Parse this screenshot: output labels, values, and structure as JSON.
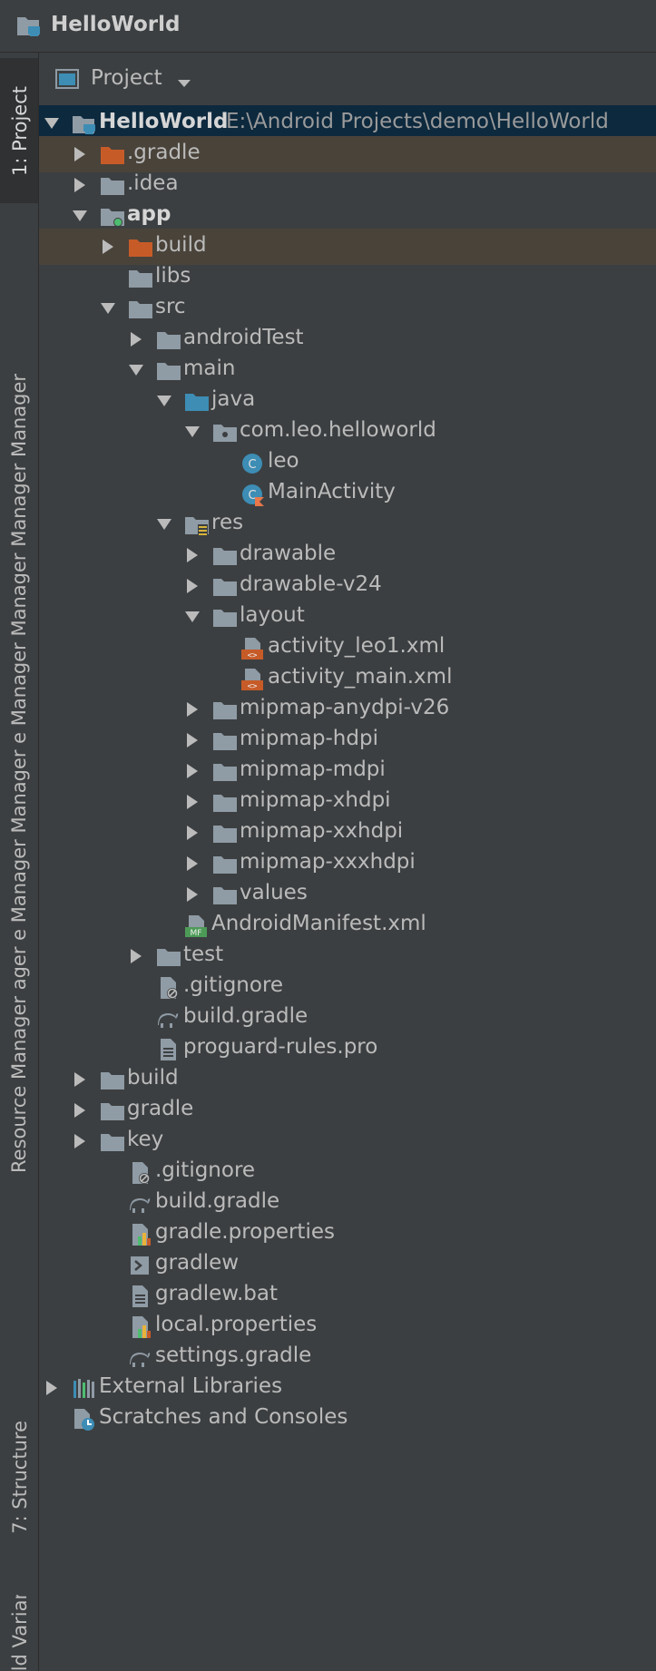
{
  "window": {
    "title": "HelloWorld"
  },
  "toolwindow_stripe": {
    "project_tab": "1: Project",
    "resource_tab": "Resource Manager  ager  e Manager  Manager  e Manager  Manager  Manager  Manager",
    "structure_tab": "7: Structure",
    "build_variants_tab": "Build Variants"
  },
  "panel": {
    "view_label": "Project"
  },
  "tree": [
    {
      "label": "HelloWorld",
      "level": 0,
      "arrow": "down",
      "icon": "project",
      "bold": true,
      "path": "E:\\Android Projects\\demo\\HelloWorld",
      "state": "selected"
    },
    {
      "label": ".gradle",
      "level": 1,
      "arrow": "right",
      "icon": "folder-excluded",
      "state": "excluded"
    },
    {
      "label": ".idea",
      "level": 1,
      "arrow": "right",
      "icon": "folder"
    },
    {
      "label": "app",
      "level": 1,
      "arrow": "down",
      "icon": "module",
      "bold": true
    },
    {
      "label": "build",
      "level": 2,
      "arrow": "right",
      "icon": "folder-excluded",
      "state": "excluded"
    },
    {
      "label": "libs",
      "level": 2,
      "icon": "folder"
    },
    {
      "label": "src",
      "level": 2,
      "arrow": "down",
      "icon": "folder"
    },
    {
      "label": "androidTest",
      "level": 3,
      "arrow": "right",
      "icon": "folder"
    },
    {
      "label": "main",
      "level": 3,
      "arrow": "down",
      "icon": "folder"
    },
    {
      "label": "java",
      "level": 4,
      "arrow": "down",
      "icon": "folder-source"
    },
    {
      "label": "com.leo.helloworld",
      "level": 5,
      "arrow": "down",
      "icon": "package"
    },
    {
      "label": "leo",
      "level": 6,
      "icon": "class"
    },
    {
      "label": "MainActivity",
      "level": 6,
      "icon": "kotlin-class"
    },
    {
      "label": "res",
      "level": 4,
      "arrow": "down",
      "icon": "folder-res"
    },
    {
      "label": "drawable",
      "level": 5,
      "arrow": "right",
      "icon": "folder"
    },
    {
      "label": "drawable-v24",
      "level": 5,
      "arrow": "right",
      "icon": "folder"
    },
    {
      "label": "layout",
      "level": 5,
      "arrow": "down",
      "icon": "folder"
    },
    {
      "label": "activity_leo1.xml",
      "level": 6,
      "icon": "xml-file"
    },
    {
      "label": "activity_main.xml",
      "level": 6,
      "icon": "xml-file"
    },
    {
      "label": "mipmap-anydpi-v26",
      "level": 5,
      "arrow": "right",
      "icon": "folder"
    },
    {
      "label": "mipmap-hdpi",
      "level": 5,
      "arrow": "right",
      "icon": "folder"
    },
    {
      "label": "mipmap-mdpi",
      "level": 5,
      "arrow": "right",
      "icon": "folder"
    },
    {
      "label": "mipmap-xhdpi",
      "level": 5,
      "arrow": "right",
      "icon": "folder"
    },
    {
      "label": "mipmap-xxhdpi",
      "level": 5,
      "arrow": "right",
      "icon": "folder"
    },
    {
      "label": "mipmap-xxxhdpi",
      "level": 5,
      "arrow": "right",
      "icon": "folder"
    },
    {
      "label": "values",
      "level": 5,
      "arrow": "right",
      "icon": "folder"
    },
    {
      "label": "AndroidManifest.xml",
      "level": 4,
      "icon": "manifest-file"
    },
    {
      "label": "test",
      "level": 3,
      "arrow": "right",
      "icon": "folder"
    },
    {
      "label": ".gitignore",
      "level": 3,
      "icon": "ignore-file"
    },
    {
      "label": "build.gradle",
      "level": 3,
      "icon": "gradle-file"
    },
    {
      "label": "proguard-rules.pro",
      "level": 3,
      "icon": "text-file"
    },
    {
      "label": "build",
      "level": 1,
      "arrow": "right",
      "icon": "folder"
    },
    {
      "label": "gradle",
      "level": 1,
      "arrow": "right",
      "icon": "folder"
    },
    {
      "label": "key",
      "level": 1,
      "arrow": "right",
      "icon": "folder"
    },
    {
      "label": ".gitignore",
      "level": 2,
      "icon": "ignore-file"
    },
    {
      "label": "build.gradle",
      "level": 2,
      "icon": "gradle-file"
    },
    {
      "label": "gradle.properties",
      "level": 2,
      "icon": "properties-file"
    },
    {
      "label": "gradlew",
      "level": 2,
      "icon": "script-file"
    },
    {
      "label": "gradlew.bat",
      "level": 2,
      "icon": "text-file"
    },
    {
      "label": "local.properties",
      "level": 2,
      "icon": "properties-file"
    },
    {
      "label": "settings.gradle",
      "level": 2,
      "icon": "gradle-file"
    },
    {
      "label": "External Libraries",
      "level": 0,
      "arrow": "right",
      "icon": "libraries"
    },
    {
      "label": "Scratches and Consoles",
      "level": 0,
      "icon": "scratches"
    }
  ],
  "colors": {
    "background": "#3c3f41",
    "selection": "#0d293e",
    "excluded_row": "#49433a",
    "excluded_folder": "#c75b28",
    "folder": "#8f9ba5",
    "source_folder": "#3d8db5",
    "text": "#bbbbbb"
  }
}
